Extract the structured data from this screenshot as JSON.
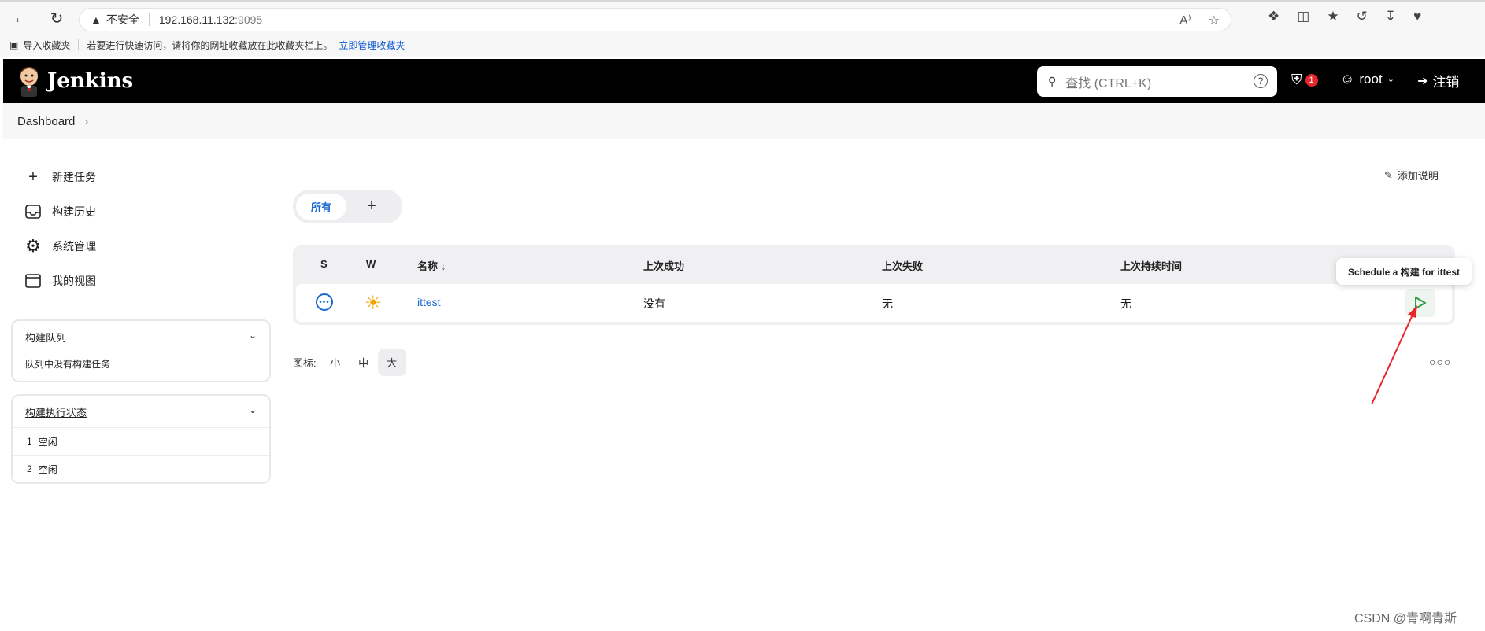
{
  "browser": {
    "insecure_label": "不安全",
    "url_host": "192.168.11.132",
    "url_port": ":9095"
  },
  "bookmarks": {
    "import_label": "导入收藏夹",
    "hint_text": "若要进行快速访问，请将你的网址收藏放在此收藏夹栏上。",
    "manage_link": "立即管理收藏夹"
  },
  "header": {
    "app_name": "Jenkins",
    "search_placeholder": "查找 (CTRL+K)",
    "security_count": "1",
    "user_name": "root",
    "logout_label": "注销"
  },
  "breadcrumb": {
    "items": [
      "Dashboard"
    ]
  },
  "sidebar": {
    "tasks": [
      {
        "label": "新建任务",
        "icon": "plus-icon"
      },
      {
        "label": "构建历史",
        "icon": "inbox-icon"
      },
      {
        "label": "系统管理",
        "icon": "gear-icon"
      },
      {
        "label": "我的视图",
        "icon": "window-icon"
      }
    ],
    "build_queue": {
      "title": "构建队列",
      "empty_text": "队列中没有构建任务"
    },
    "executor_status": {
      "title": "构建执行状态",
      "executors": [
        {
          "num": "1",
          "state": "空闲"
        },
        {
          "num": "2",
          "state": "空闲"
        }
      ]
    }
  },
  "main": {
    "add_description": "添加说明",
    "tabs": [
      {
        "label": "所有"
      }
    ],
    "table": {
      "headers": {
        "s": "S",
        "w": "W",
        "name": "名称",
        "sort_indicator": "↓",
        "last_success": "上次成功",
        "last_failure": "上次失败",
        "last_duration": "上次持续时间"
      },
      "rows": [
        {
          "name": "ittest",
          "last_success": "没有",
          "last_failure": "无",
          "last_duration": "无"
        }
      ]
    },
    "tooltip": "Schedule a 构建 for ittest",
    "icon_size": {
      "label": "图标:",
      "options": [
        "小",
        "中",
        "大"
      ],
      "selected": "大"
    }
  },
  "watermark": "CSDN @青啊青斯",
  "colors": {
    "header_bg": "#000000",
    "link": "#1967d2",
    "badge": "#e5262d",
    "run_green": "#2e9e44",
    "annotation_arrow": "#e8262a"
  }
}
